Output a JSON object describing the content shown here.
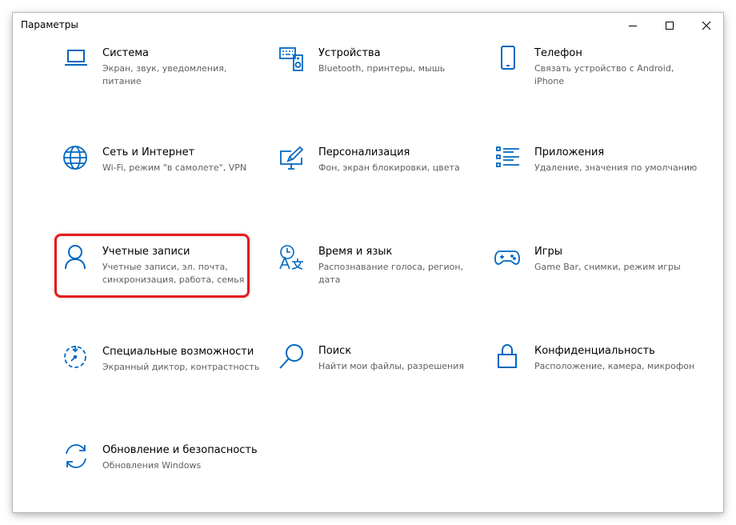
{
  "window": {
    "title": "Параметры",
    "controls": {
      "minimize": "minimize-icon",
      "maximize": "maximize-icon",
      "close": "close-icon"
    }
  },
  "accent_color": "#0067c0",
  "highlight_color": "#e21c1c",
  "categories": [
    {
      "name": "Система",
      "description": "Экран, звук, уведомления, питание",
      "icon": "laptop-icon"
    },
    {
      "name": "Устройства",
      "description": "Bluetooth, принтеры, мышь",
      "icon": "devices-icon"
    },
    {
      "name": "Телефон",
      "description": "Связать устройство с Android, iPhone",
      "icon": "phone-icon"
    },
    {
      "name": "Сеть и Интернет",
      "description": "Wi-Fi, режим \"в самолете\", VPN",
      "icon": "globe-icon"
    },
    {
      "name": "Персонализация",
      "description": "Фон, экран блокировки, цвета",
      "icon": "personalization-icon"
    },
    {
      "name": "Приложения",
      "description": "Удаление, значения по умолчанию",
      "icon": "apps-list-icon"
    },
    {
      "name": "Учетные записи",
      "description": "Учетные записи, эл. почта, синхронизация, работа, семья",
      "icon": "person-icon",
      "highlighted": true
    },
    {
      "name": "Время и язык",
      "description": "Распознавание голоса, регион, дата",
      "icon": "time-language-icon"
    },
    {
      "name": "Игры",
      "description": "Game Bar, снимки, режим игры",
      "icon": "gamepad-icon"
    },
    {
      "name": "Специальные возможности",
      "description": "Экранный диктор, контрастность",
      "icon": "accessibility-timer-icon"
    },
    {
      "name": "Поиск",
      "description": "Найти мои файлы, разрешения",
      "icon": "search-icon"
    },
    {
      "name": "Конфиденциальность",
      "description": "Расположение, камера, микрофон",
      "icon": "lock-icon"
    },
    {
      "name": "Обновление и безопасность",
      "description": "Обновления Windows",
      "icon": "sync-icon"
    }
  ]
}
